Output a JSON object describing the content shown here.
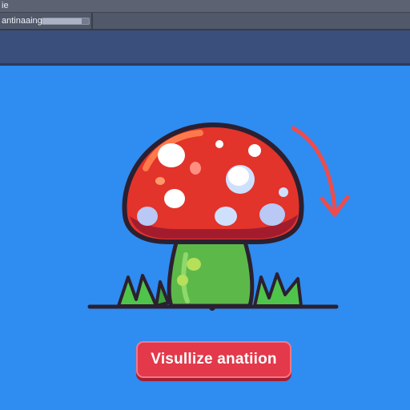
{
  "window": {
    "title": "ie"
  },
  "toolbar": {
    "status_label": "antinaaing",
    "progress": 0.85
  },
  "main": {
    "action_button_label": "Visullize anatiion"
  },
  "icons": {
    "illustration": "mushroom-illustration",
    "arrow": "curved-arrow-icon"
  },
  "colors": {
    "canvas_background": "#2f8cf0",
    "button_fill": "#e3394a",
    "mushroom_cap": "#e2342b",
    "mushroom_stem": "#5db84a",
    "arrow": "#ee4c4c"
  }
}
